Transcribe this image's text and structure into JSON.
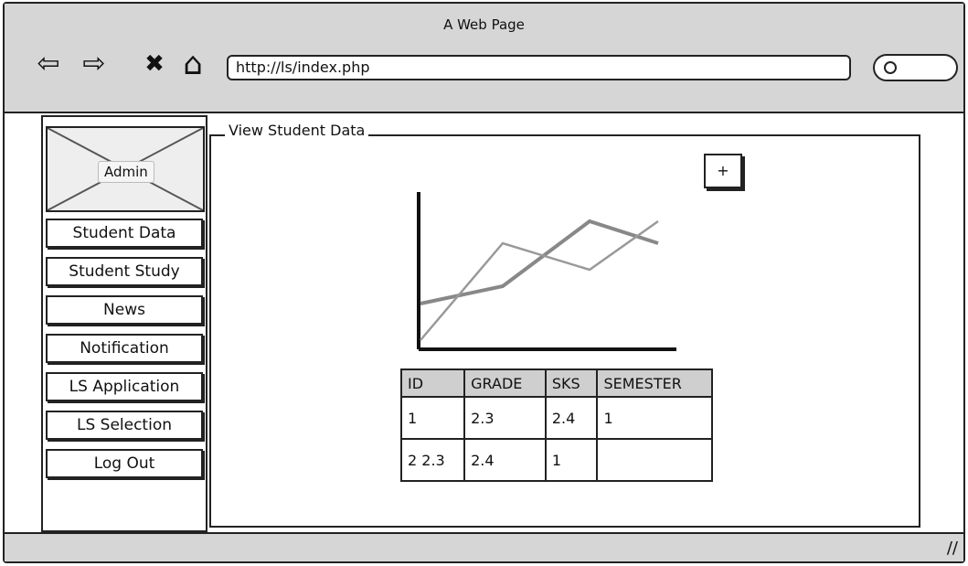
{
  "browser": {
    "title": "A Web Page",
    "url": "http://ls/index.php",
    "buttons": {
      "back": "⇦",
      "forward": "⇨",
      "stop": "✖",
      "home": "⌂"
    }
  },
  "sidebar": {
    "admin_label": "Admin",
    "items": [
      {
        "label": "Student Data"
      },
      {
        "label": "Student Study"
      },
      {
        "label": "News"
      },
      {
        "label": "Notification"
      },
      {
        "label": "LS Application"
      },
      {
        "label": "LS Selection"
      },
      {
        "label": "Log Out"
      }
    ]
  },
  "panel": {
    "title": "View Student Data",
    "add_label": "+"
  },
  "table": {
    "headers": [
      "ID",
      "GRADE",
      "SKS",
      "SEMESTER"
    ],
    "rows": [
      [
        "1",
        "2.3",
        "2.4",
        "1"
      ],
      [
        "2 2.3",
        "2.4",
        "1",
        ""
      ]
    ]
  },
  "statusbar": {
    "resize_glyph": "//"
  }
}
